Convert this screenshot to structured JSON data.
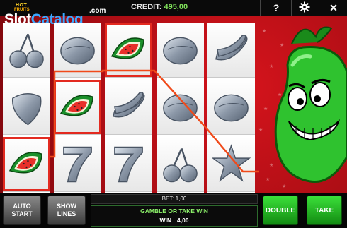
{
  "header": {
    "credit_label": "CREDIT:",
    "credit_value": "495,00",
    "help_icon": "question-mark-icon",
    "settings_icon": "gear-icon",
    "close_icon": "close-icon"
  },
  "logo": {
    "hot": "HOT",
    "fruits": "FRUITS",
    "slot": "Slot",
    "catalog": "Catalog",
    "com": ".com"
  },
  "reels": [
    [
      "cherry",
      "strawberry",
      "watermelon"
    ],
    [
      "plum",
      "watermelon",
      "seven"
    ],
    [
      "watermelon",
      "banana",
      "seven"
    ],
    [
      "plum",
      "plum",
      "cherry"
    ],
    [
      "banana",
      "plum",
      "star"
    ]
  ],
  "winning_cells": [
    [
      0,
      2
    ],
    [
      1,
      1
    ],
    [
      2,
      0
    ]
  ],
  "controls": {
    "auto_start": "AUTO START",
    "show_lines": "SHOW LINES",
    "bet_label": "BET:",
    "bet_value": "1,00",
    "message": "GAMBLE OR TAKE WIN",
    "win_label": "WIN",
    "win_value": "4,00",
    "double": "DOUBLE",
    "take": "TAKE"
  },
  "colors": {
    "background_red": "#c4121a",
    "win_highlight": "#e32a20",
    "button_green": "#22b822",
    "credit_green": "#7fe05a"
  }
}
